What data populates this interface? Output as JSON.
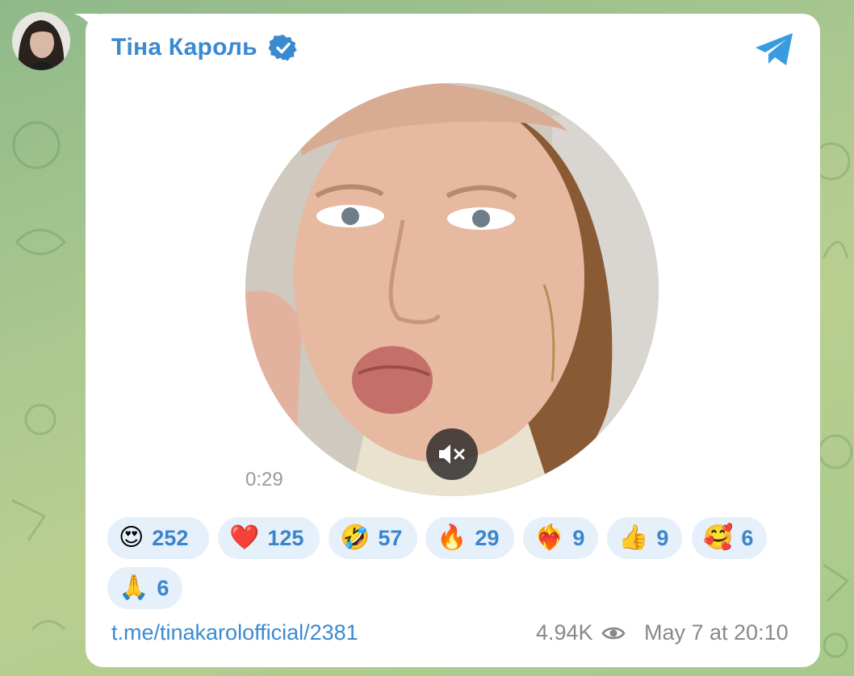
{
  "channel": {
    "name": "Тіна Кароль",
    "verified": true
  },
  "video": {
    "duration": "0:29",
    "muted": true
  },
  "reactions": [
    {
      "emoji": "😍",
      "count": "252"
    },
    {
      "emoji": "❤️",
      "count": "125"
    },
    {
      "emoji": "🤣",
      "count": "57"
    },
    {
      "emoji": "🔥",
      "count": "29"
    },
    {
      "emoji": "❤️‍🔥",
      "count": "9"
    },
    {
      "emoji": "👍",
      "count": "9"
    },
    {
      "emoji": "🥰",
      "count": "6"
    },
    {
      "emoji": "🙏",
      "count": "6"
    }
  ],
  "footer": {
    "link": "t.me/tinakarolofficial/2381",
    "views": "4.94K",
    "date": "May 7 at 20:10"
  },
  "colors": {
    "accent": "#3a8ad0",
    "reaction_bg": "#e6f0fb",
    "meta": "#888888"
  }
}
